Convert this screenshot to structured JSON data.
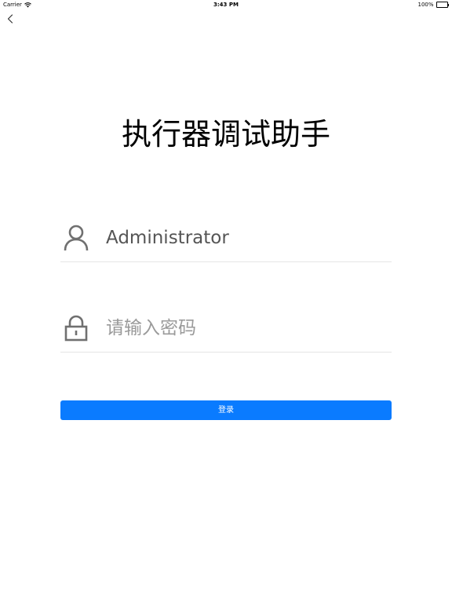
{
  "status_bar": {
    "carrier": "Carrier",
    "time": "3:43 PM",
    "battery": "100%"
  },
  "navigation": {
    "back_icon": "chevron-left-icon"
  },
  "title": "执行器调试助手",
  "form": {
    "username": {
      "icon": "user-icon",
      "value": "Administrator",
      "placeholder": ""
    },
    "password": {
      "icon": "lock-icon",
      "value": "",
      "placeholder": "请输入密码"
    },
    "login_label": "登录"
  },
  "colors": {
    "accent": "#0a7bff",
    "icon": "#707070",
    "divider": "#e5e5e5",
    "background": "#ffffff"
  }
}
